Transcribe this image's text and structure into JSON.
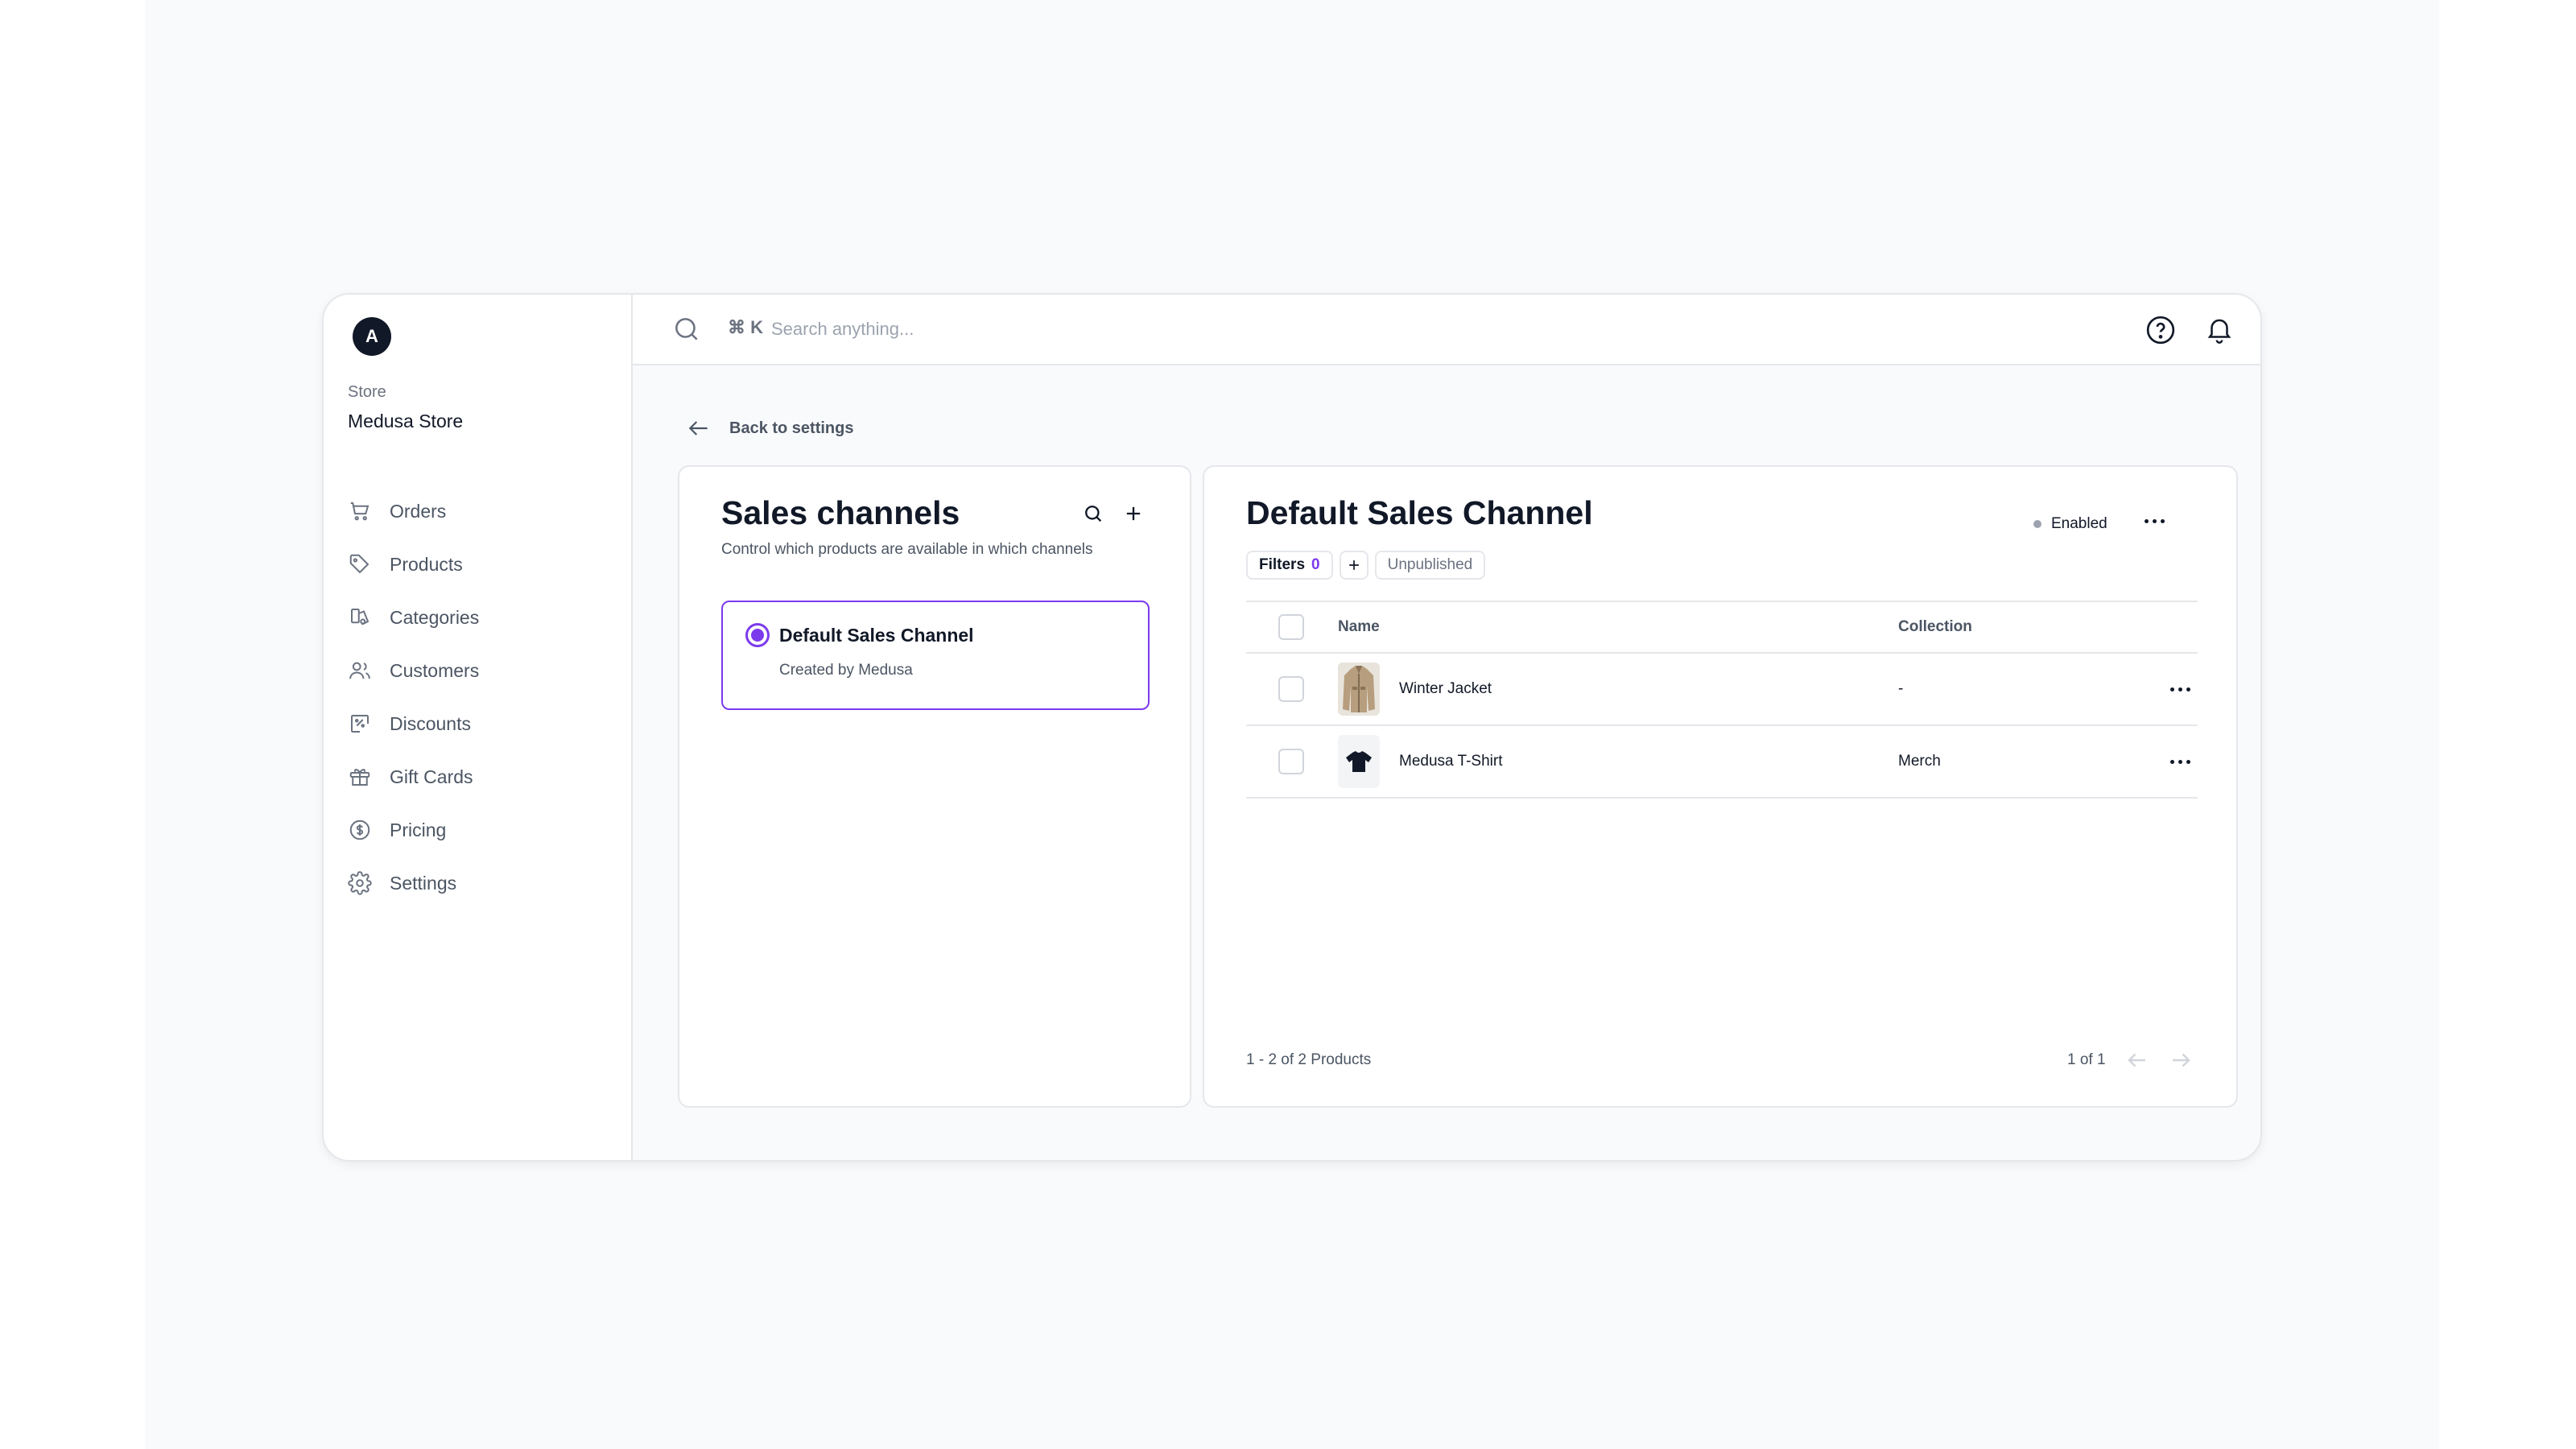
{
  "store": {
    "avatar_letter": "A",
    "label": "Store",
    "name": "Medusa Store"
  },
  "sidebar": {
    "items": [
      {
        "label": "Orders",
        "icon": "cart-icon"
      },
      {
        "label": "Products",
        "icon": "tag-icon"
      },
      {
        "label": "Categories",
        "icon": "categories-icon"
      },
      {
        "label": "Customers",
        "icon": "users-icon"
      },
      {
        "label": "Discounts",
        "icon": "discount-icon"
      },
      {
        "label": "Gift Cards",
        "icon": "gift-icon"
      },
      {
        "label": "Pricing",
        "icon": "pricing-icon"
      },
      {
        "label": "Settings",
        "icon": "gear-icon"
      }
    ]
  },
  "topbar": {
    "shortcut": "⌘ K",
    "search_placeholder": "Search anything..."
  },
  "back_link": "Back to settings",
  "sales_channels": {
    "title": "Sales channels",
    "subtitle": "Control which products are available in which channels",
    "channels": [
      {
        "name": "Default Sales Channel",
        "creator": "Created by Medusa",
        "selected": true
      }
    ]
  },
  "detail": {
    "title": "Default Sales Channel",
    "status": "Enabled",
    "filters": {
      "label": "Filters",
      "count": "0",
      "active_filter": "Unpublished"
    },
    "table": {
      "headers": {
        "name": "Name",
        "collection": "Collection"
      },
      "rows": [
        {
          "name": "Winter Jacket",
          "collection": "-"
        },
        {
          "name": "Medusa T-Shirt",
          "collection": "Merch"
        }
      ]
    },
    "footer_count": "1 - 2 of 2 Products",
    "page_info": "1 of 1"
  },
  "colors": {
    "accent": "#7c3aed",
    "status_dot": "#9ca3af",
    "border": "#e5e7eb"
  }
}
